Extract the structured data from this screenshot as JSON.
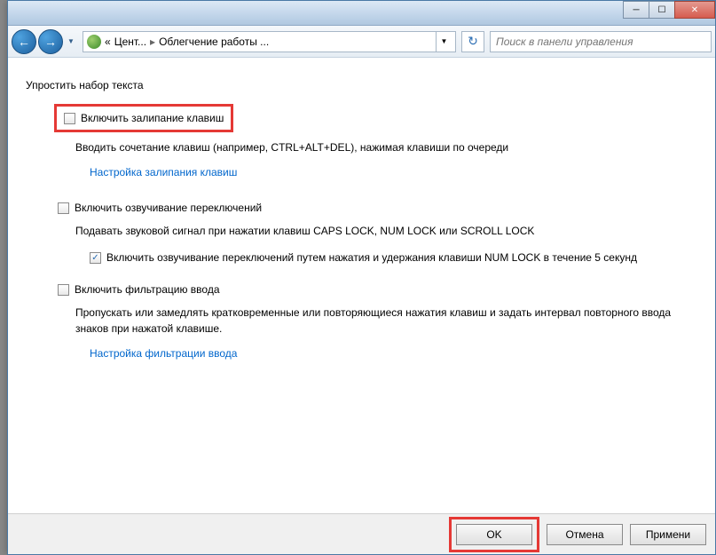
{
  "titlebar": {
    "minimize": "─",
    "maximize": "☐",
    "close": "✕"
  },
  "nav": {
    "back": "←",
    "forward": "→",
    "drop": "▼"
  },
  "breadcrumb": {
    "prefix": "«",
    "item1": "Цент...",
    "item2": "Облегчение работы ...",
    "sep": "▸",
    "drop": "▼"
  },
  "refresh": "↻",
  "search": {
    "placeholder": "Поиск в панели управления"
  },
  "group_title": "Упростить набор текста",
  "sticky": {
    "label": "Включить залипание клавиш",
    "desc": "Вводить сочетание клавиш (например, CTRL+ALT+DEL), нажимая клавиши по очереди",
    "link": "Настройка залипания клавиш"
  },
  "toggle": {
    "label": "Включить озвучивание переключений",
    "desc": "Подавать звуковой сигнал при нажатии клавиш CAPS LOCK, NUM LOCK или SCROLL LOCK",
    "sub_label": "Включить озвучивание переключений путем нажатия и удержания клавиши NUM LOCK в течение 5 секунд"
  },
  "filter": {
    "label": "Включить фильтрацию ввода",
    "desc": "Пропускать или замедлять кратковременные или повторяющиеся нажатия клавиш и задать интервал повторного ввода знаков при нажатой клавише.",
    "link": "Настройка фильтрации ввода"
  },
  "buttons": {
    "ok": "OK",
    "cancel": "Отмена",
    "apply": "Примени"
  }
}
